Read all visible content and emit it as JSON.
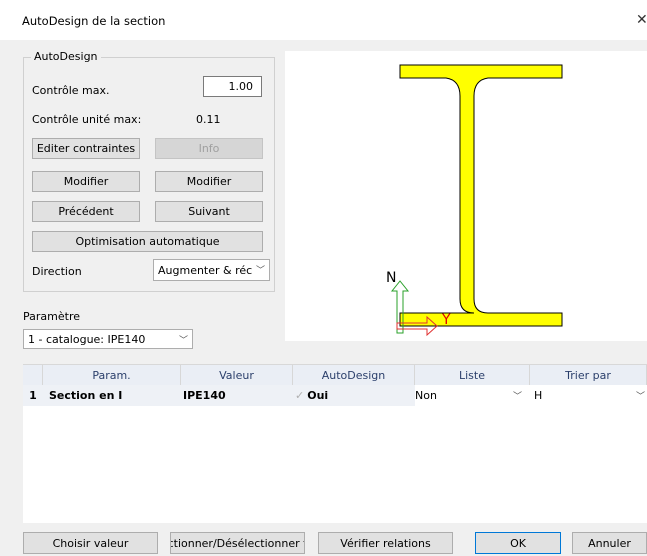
{
  "window": {
    "title": "AutoDesign de la section"
  },
  "autodesign": {
    "group_label": "AutoDesign",
    "max_check_label": "Contrôle max.",
    "max_check_value": "1.00",
    "unit_check_label": "Contrôle unité max:",
    "unit_check_value": "0.11",
    "edit_constraints_label": "Editer contraintes",
    "info_label": "Info",
    "modify_left_label": "Modifier",
    "modify_right_label": "Modifier",
    "previous_label": "Précédent",
    "next_label": "Suivant",
    "auto_opt_label": "Optimisation automatique",
    "direction_label": "Direction",
    "direction_value": "Augmenter & réc"
  },
  "parameter": {
    "label": "Paramètre",
    "value": "1 - catalogue: IPE140"
  },
  "preview": {
    "axis_n": "N",
    "axis_y": "Y",
    "section_color": "#ffff00"
  },
  "table": {
    "columns": [
      "Param.",
      "Valeur",
      "AutoDesign",
      "Liste",
      "Trier par"
    ],
    "rows": [
      {
        "index": "1",
        "param": "Section en I",
        "value": "IPE140",
        "autodesign": "Oui",
        "list": "Non",
        "sort": "H"
      }
    ]
  },
  "footer": {
    "choose_value": "Choisir valeur",
    "select_deselect": "ctionner/Désélectionner t",
    "check_relations": "Vérifier relations",
    "ok": "OK",
    "cancel": "Annuler"
  }
}
